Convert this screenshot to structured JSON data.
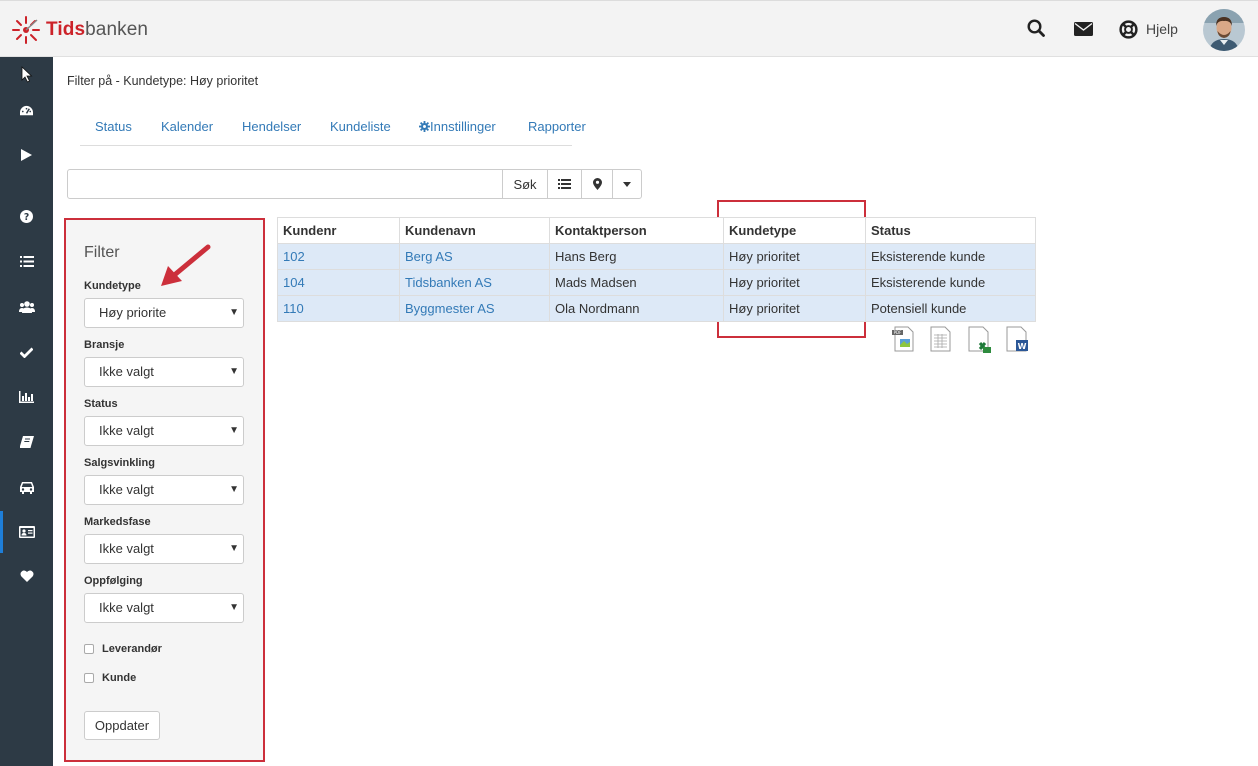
{
  "app": {
    "logo_part1": "Tids",
    "logo_part2": "banken"
  },
  "topbar": {
    "help_label": "Hjelp"
  },
  "sidebar": {
    "items": [
      "cursor-icon",
      "dashboard-icon",
      "play-icon",
      "help-icon",
      "list-icon",
      "users-icon",
      "check-icon",
      "bar-chart-icon",
      "book-icon",
      "car-icon",
      "id-card-icon",
      "heart-icon"
    ]
  },
  "breadcrumb": "Filter på - Kundetype: Høy prioritet",
  "tabs": [
    "Status",
    "Kalender",
    "Hendelser",
    "Kundeliste",
    "Innstillinger",
    "Rapporter"
  ],
  "search": {
    "value": "",
    "button_label": "Søk"
  },
  "filter": {
    "title": "Filter",
    "fields": [
      {
        "label": "Kundetype",
        "value": "Høy priorite"
      },
      {
        "label": "Bransje",
        "value": "Ikke valgt"
      },
      {
        "label": "Status",
        "value": "Ikke valgt"
      },
      {
        "label": "Salgsvinkling",
        "value": "Ikke valgt"
      },
      {
        "label": "Markedsfase",
        "value": "Ikke valgt"
      },
      {
        "label": "Oppfølging",
        "value": "Ikke valgt"
      }
    ],
    "checkboxes": [
      {
        "label": "Leverandør",
        "checked": false
      },
      {
        "label": "Kunde",
        "checked": false
      }
    ],
    "submit_label": "Oppdater"
  },
  "table": {
    "columns": [
      "Kundenr",
      "Kundenavn",
      "Kontaktperson",
      "Kundetype",
      "Status"
    ],
    "rows": [
      [
        "102",
        "Berg AS",
        "Hans Berg",
        "Høy prioritet",
        "Eksisterende kunde"
      ],
      [
        "104",
        "Tidsbanken AS",
        "Mads Madsen",
        "Høy prioritet",
        "Eksisterende kunde"
      ],
      [
        "110",
        "Byggmester AS",
        "Ola Nordmann",
        "Høy prioritet",
        "Potensiell kunde"
      ]
    ]
  },
  "exports": [
    "pdf-export-icon",
    "csv-export-icon",
    "excel-export-icon",
    "word-export-icon"
  ],
  "colors": {
    "brand": "#cc2229",
    "sidebar": "#2d3a45",
    "link": "#337ab7",
    "highlight": "#cc2f3b",
    "row_bg": "#dde9f7"
  }
}
